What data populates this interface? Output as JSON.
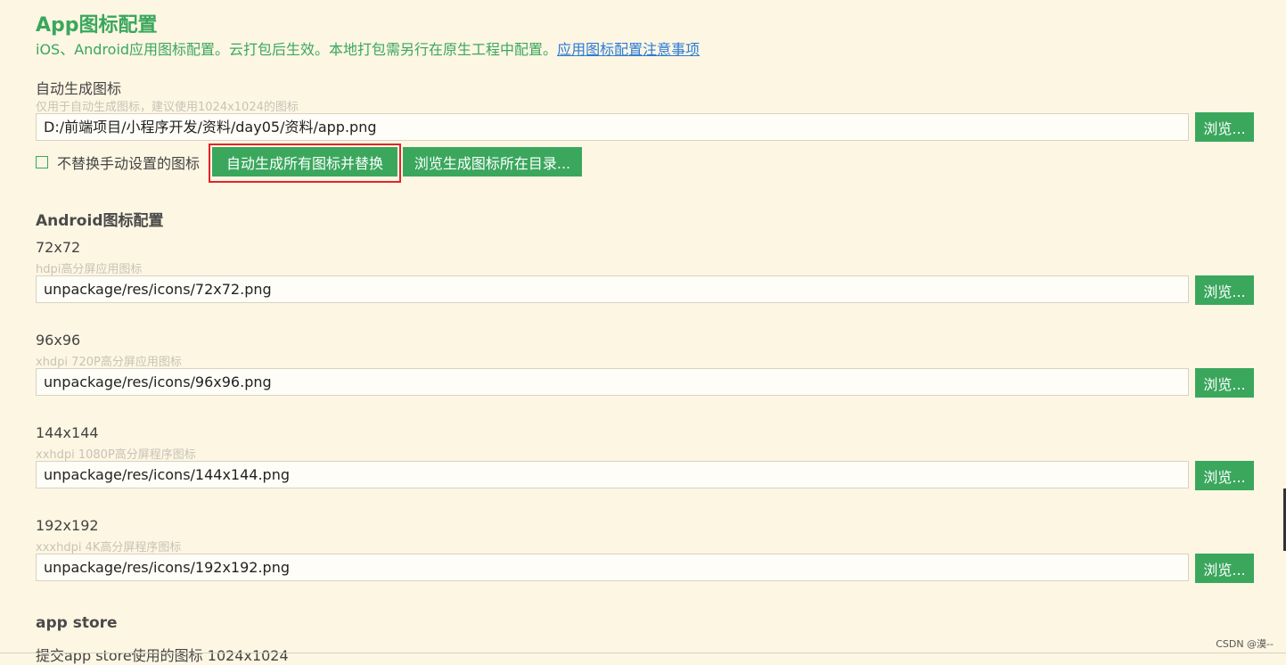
{
  "header": {
    "title": "App图标配置",
    "subtitle": "iOS、Android应用图标配置。云打包后生效。本地打包需另行在原生工程中配置。",
    "link": "应用图标配置注意事项"
  },
  "auto": {
    "label": "自动生成图标",
    "hint": "仅用于自动生成图标，建议使用1024x1024的图标",
    "value": "D:/前端项目/小程序开发/资料/day05/资料/app.png",
    "browse": "浏览...",
    "checkbox_label": "不替换手动设置的图标",
    "generate_button": "自动生成所有图标并替换",
    "browse_dir_button": "浏览生成图标所在目录..."
  },
  "android": {
    "section_title": "Android图标配置",
    "items": [
      {
        "label": "72x72",
        "hint": "hdpi高分屏应用图标",
        "value": "unpackage/res/icons/72x72.png",
        "browse": "浏览..."
      },
      {
        "label": "96x96",
        "hint": "xhdpi 720P高分屏应用图标",
        "value": "unpackage/res/icons/96x96.png",
        "browse": "浏览..."
      },
      {
        "label": "144x144",
        "hint": "xxhdpi 1080P高分屏程序图标",
        "value": "unpackage/res/icons/144x144.png",
        "browse": "浏览..."
      },
      {
        "label": "192x192",
        "hint": "xxxhdpi 4K高分屏程序图标",
        "value": "unpackage/res/icons/192x192.png",
        "browse": "浏览..."
      }
    ]
  },
  "appstore": {
    "section_title": "app store",
    "partial_label": "提交app store使用的图标 1024x1024"
  },
  "watermark": "CSDN @漠--",
  "colors": {
    "background": "#fdf6e3",
    "accent": "#3aa75d",
    "link": "#2b7bd6",
    "highlight_border": "#e0242b"
  }
}
